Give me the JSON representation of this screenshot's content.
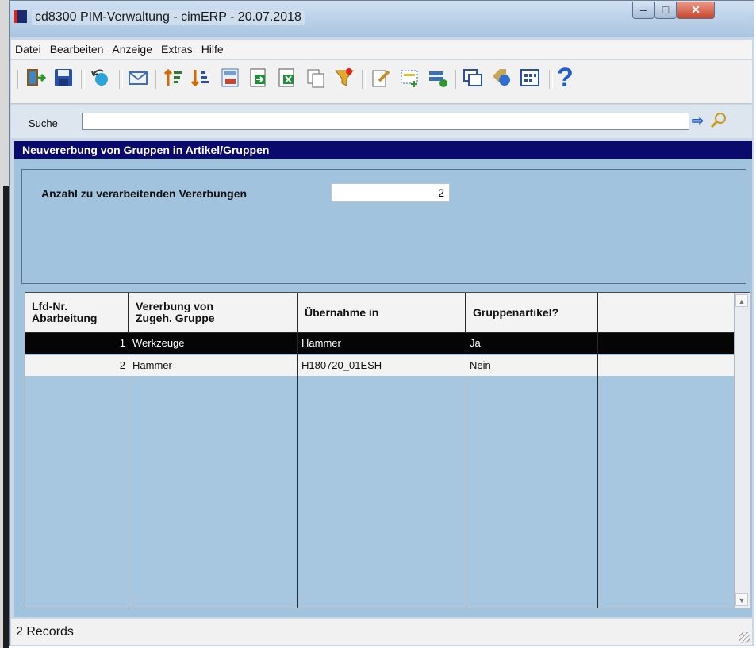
{
  "window": {
    "title": "cd8300 PIM-Verwaltung - cimERP - 20.07.2018",
    "controls": {
      "minimize": "–",
      "maximize": "□",
      "close": "✕"
    }
  },
  "menu": {
    "items": [
      "Datei",
      "Bearbeiten",
      "Anzeige",
      "Extras",
      "Hilfe"
    ]
  },
  "toolbar": {
    "icons": [
      "exit-icon",
      "save-icon",
      "rotate-icon",
      "mail-icon",
      "sort-ascending-icon",
      "sort-descending-icon",
      "calculator-icon",
      "export-icon",
      "excel-icon",
      "copy-icon",
      "filter-icon",
      "edit-icon",
      "selection-icon",
      "transfer-icon",
      "windows-icon",
      "tags-icon",
      "grid-icon",
      "help-icon"
    ],
    "help_label": "?"
  },
  "search": {
    "label": "Suche",
    "value": "",
    "go_arrow": "⇨"
  },
  "section": {
    "title": "Neuvererbung von Gruppen in Artikel/Gruppen"
  },
  "form": {
    "count_label": "Anzahl zu verarbeitenden Vererbungen",
    "count_value": "2"
  },
  "table": {
    "headers": [
      "Lfd-Nr.\nAbarbeitung",
      "Vererbung von\nZugeh. Gruppe",
      "Übernahme in",
      "Gruppenartikel?",
      ""
    ],
    "rows": [
      {
        "nr": "1",
        "gruppe": "Werkzeuge",
        "uebernahme": "Hammer",
        "gruppenartikel": "Ja",
        "extra": "",
        "selected": true
      },
      {
        "nr": "2",
        "gruppe": "Hammer",
        "uebernahme": "H180720_01ESH",
        "gruppenartikel": "Nein",
        "extra": "",
        "selected": false
      }
    ],
    "scroll_up": "▲",
    "scroll_down": "▼"
  },
  "status": {
    "records": "2 Records"
  },
  "colors": {
    "title_band": "#0a0a6e",
    "panel": "#a2c3de",
    "selected_row": "#050505"
  }
}
